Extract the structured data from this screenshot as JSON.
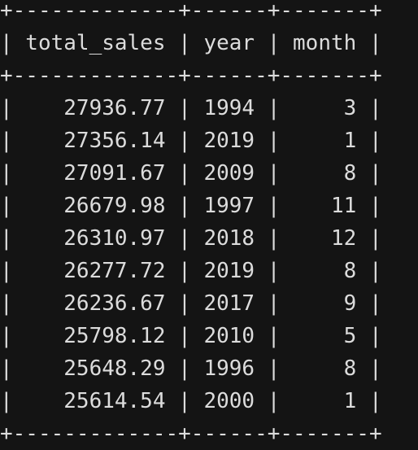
{
  "table": {
    "border_line": "+-------------+------+-------+",
    "header_line": "| total_sales | year | month |",
    "columns": [
      "total_sales",
      "year",
      "month"
    ],
    "rows": [
      [
        "27936.77",
        "1994",
        "3"
      ],
      [
        "27356.14",
        "2019",
        "1"
      ],
      [
        "27091.67",
        "2009",
        "8"
      ],
      [
        "26679.98",
        "1997",
        "11"
      ],
      [
        "26310.97",
        "2018",
        "12"
      ],
      [
        "26277.72",
        "2019",
        "8"
      ],
      [
        "26236.67",
        "2017",
        "9"
      ],
      [
        "25798.12",
        "2010",
        "5"
      ],
      [
        "25648.29",
        "1996",
        "8"
      ],
      [
        "25614.54",
        "2000",
        "1"
      ]
    ]
  },
  "colors": {
    "background": "#141414",
    "text": "#dcdcdc"
  }
}
